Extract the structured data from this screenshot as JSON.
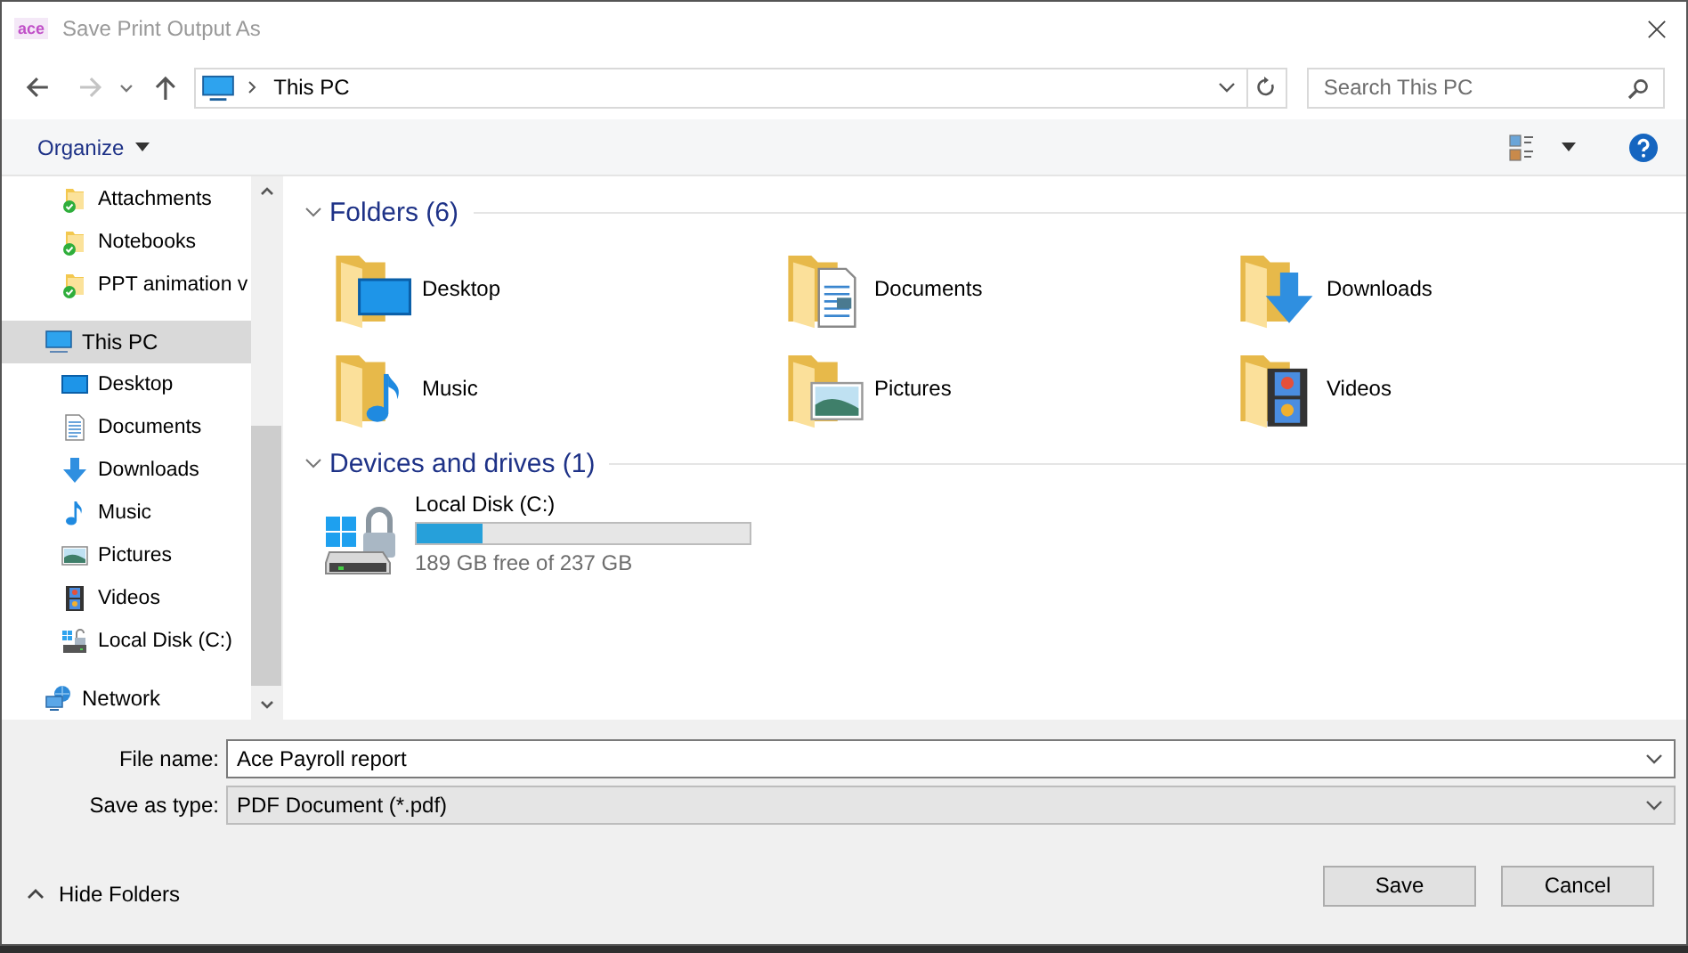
{
  "window": {
    "app_icon_text": "ace",
    "title": "Save Print Output As"
  },
  "navigation": {
    "back": {
      "disabled": false
    },
    "forward": {
      "disabled": true
    },
    "path": [
      "This PC"
    ],
    "search": {
      "placeholder": "Search This PC"
    }
  },
  "toolbar": {
    "organize": "Organize"
  },
  "sidebar": {
    "items": [
      {
        "label": "Attachments",
        "kind": "synced-folder",
        "selected": false
      },
      {
        "label": "Notebooks",
        "kind": "synced-folder",
        "selected": false
      },
      {
        "label": "PPT animation v",
        "kind": "synced-folder",
        "selected": false
      },
      {
        "label": "This PC",
        "kind": "pc",
        "selected": true,
        "children": [
          {
            "label": "Desktop",
            "kind": "desktop",
            "selected": false
          },
          {
            "label": "Documents",
            "kind": "documents",
            "selected": false
          },
          {
            "label": "Downloads",
            "kind": "downloads",
            "selected": false
          },
          {
            "label": "Music",
            "kind": "music",
            "selected": false
          },
          {
            "label": "Pictures",
            "kind": "pictures",
            "selected": false
          },
          {
            "label": "Videos",
            "kind": "videos",
            "selected": false
          },
          {
            "label": "Local Disk (C:)",
            "kind": "disk",
            "selected": false
          }
        ]
      },
      {
        "label": "Network",
        "kind": "network",
        "selected": false
      }
    ]
  },
  "sections": [
    {
      "title": "Folders (6)",
      "kind": "folders",
      "expanded": true,
      "items": [
        {
          "label": "Desktop",
          "kind": "desktop"
        },
        {
          "label": "Documents",
          "kind": "documents"
        },
        {
          "label": "Downloads",
          "kind": "downloads"
        },
        {
          "label": "Music",
          "kind": "music"
        },
        {
          "label": "Pictures",
          "kind": "pictures"
        },
        {
          "label": "Videos",
          "kind": "videos"
        }
      ]
    },
    {
      "title": "Devices and drives (1)",
      "kind": "drives",
      "expanded": true,
      "items": [
        {
          "label": "Local Disk (C:)",
          "level": 0.2,
          "free": "189 GB free of 237 GB"
        }
      ]
    }
  ],
  "form": {
    "file_name": {
      "label": "File name:",
      "value": "Ace Payroll report"
    },
    "save_as_type": {
      "label": "Save as type:",
      "value": "PDF Document (*.pdf)"
    }
  },
  "hide_folders": "Hide Folders",
  "buttons": [
    "Save",
    "Cancel"
  ]
}
